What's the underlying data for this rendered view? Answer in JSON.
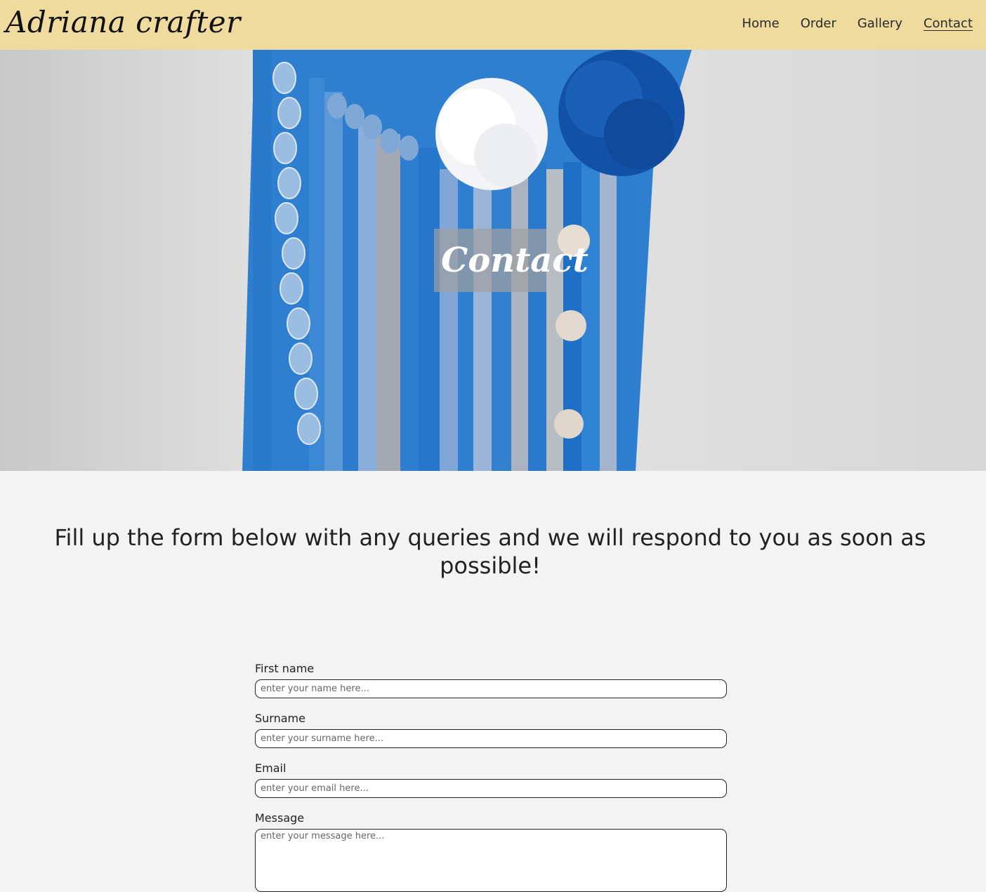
{
  "header": {
    "logo": "Adriana crafter",
    "nav": [
      {
        "label": "Home",
        "active": false
      },
      {
        "label": "Order",
        "active": false
      },
      {
        "label": "Gallery",
        "active": false
      },
      {
        "label": "Contact",
        "active": true
      }
    ]
  },
  "hero": {
    "title": "Contact"
  },
  "intro": {
    "text": "Fill up the form below with any queries and we will respond to you as soon as possible!"
  },
  "form": {
    "first_name": {
      "label": "First name",
      "placeholder": "enter your name here..."
    },
    "surname": {
      "label": "Surname",
      "placeholder": "enter your surname here..."
    },
    "email": {
      "label": "Email",
      "placeholder": "enter your email here..."
    },
    "message": {
      "label": "Message",
      "placeholder": "enter your message here..."
    }
  },
  "colors": {
    "header_bg": "#f0db9e",
    "page_bg": "#f3f3f3",
    "macrame_blue": "#2f7fd0",
    "pompom_dark_blue": "#1251a8"
  }
}
